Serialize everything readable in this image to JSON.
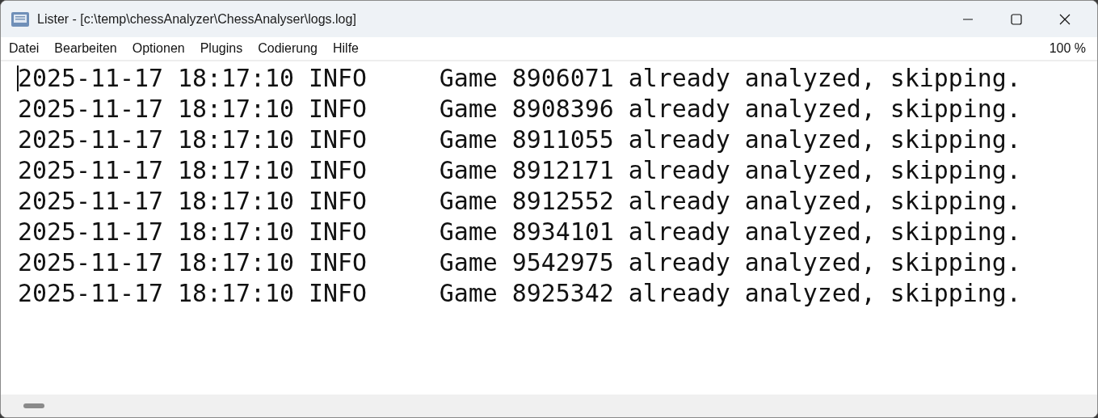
{
  "window": {
    "title": "Lister - [c:\\temp\\chessAnalyzer\\ChessAnalyser\\logs.log]"
  },
  "menu": [
    "Datei",
    "Bearbeiten",
    "Optionen",
    "Plugins",
    "Codierung",
    "Hilfe"
  ],
  "zoom": "100 %",
  "lines": [
    "2025-11-17 18:17:10 INFO     Game 8906071 already analyzed, skipping.",
    "2025-11-17 18:17:10 INFO     Game 8908396 already analyzed, skipping.",
    "2025-11-17 18:17:10 INFO     Game 8911055 already analyzed, skipping.",
    "2025-11-17 18:17:10 INFO     Game 8912171 already analyzed, skipping.",
    "2025-11-17 18:17:10 INFO     Game 8912552 already analyzed, skipping.",
    "2025-11-17 18:17:10 INFO     Game 8934101 already analyzed, skipping.",
    "2025-11-17 18:17:10 INFO     Game 9542975 already analyzed, skipping.",
    "2025-11-17 18:17:10 INFO     Game 8925342 already analyzed, skipping."
  ]
}
